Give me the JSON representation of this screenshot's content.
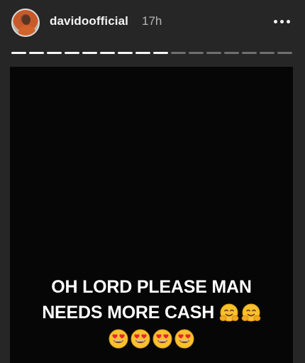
{
  "story": {
    "username": "davidoofficial",
    "timestamp": "17h",
    "progress": {
      "segments": 16,
      "completed": 9
    },
    "caption": {
      "line1": "OH LORD PLEASE MAN",
      "line2": "NEEDS MORE CASH",
      "line2_emojis": [
        "hugging-face",
        "hugging-face"
      ],
      "line3_emojis": [
        "heart-eyes",
        "heart-eyes",
        "heart-eyes",
        "heart-eyes"
      ]
    }
  },
  "icons": {
    "more": "more-horizontal-icon",
    "avatar": "profile-avatar"
  },
  "colors": {
    "background": "#262626",
    "media_background": "#060606",
    "text": "#ffffff",
    "muted": "#b5b5b5",
    "emoji_yellow": "#f8c12e",
    "emoji_heart": "#e8233a"
  }
}
